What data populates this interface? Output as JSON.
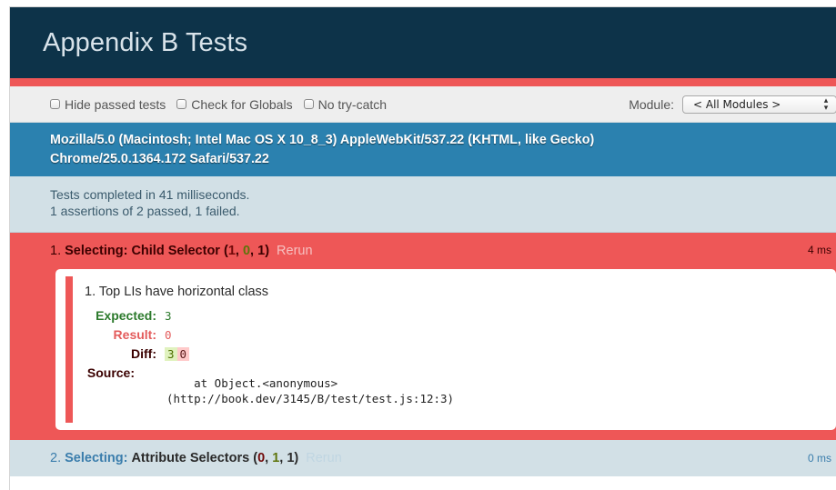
{
  "header": {
    "title": "Appendix B Tests"
  },
  "toolbar": {
    "hide_passed": "Hide passed tests",
    "check_globals": "Check for Globals",
    "no_try_catch": "No try-catch",
    "module_label": "Module:",
    "module_value": "< All Modules >"
  },
  "useragent": {
    "line1": "Mozilla/5.0 (Macintosh; Intel Mac OS X 10_8_3) AppleWebKit/537.22 (KHTML, like Gecko)",
    "line2": "Chrome/25.0.1364.172 Safari/537.22"
  },
  "summary": {
    "line1": "Tests completed in 41 milliseconds.",
    "line2": "1 assertions of 2 passed, 1 failed."
  },
  "tests": [
    {
      "number": "1.",
      "module": "Selecting:",
      "name": "Child Selector",
      "failed": "1",
      "passed": "0",
      "total": "1",
      "rerun": "Rerun",
      "duration": "4 ms",
      "assertion": {
        "title": "1. Top LIs have horizontal class",
        "expected_label": "Expected:",
        "expected_value": "3",
        "result_label": "Result:",
        "result_value": "0",
        "diff_label": "Diff:",
        "diff_ins": "3",
        "diff_del": "0",
        "source_label": "Source:",
        "source_text": "    at Object.<anonymous>\n(http://book.dev/3145/B/test/test.js:12:3)"
      }
    },
    {
      "number": "2.",
      "module": "Selecting:",
      "name": "Attribute Selectors",
      "failed": "0",
      "passed": "1",
      "total": "1",
      "rerun": "Rerun",
      "duration": "0 ms"
    }
  ],
  "colors": {
    "header_bg": "#0d3349",
    "stripe": "#ee5757",
    "useragent_bg": "#2b81af",
    "banner_bg": "#d2e0e6",
    "fail_bg": "#ee5757"
  }
}
